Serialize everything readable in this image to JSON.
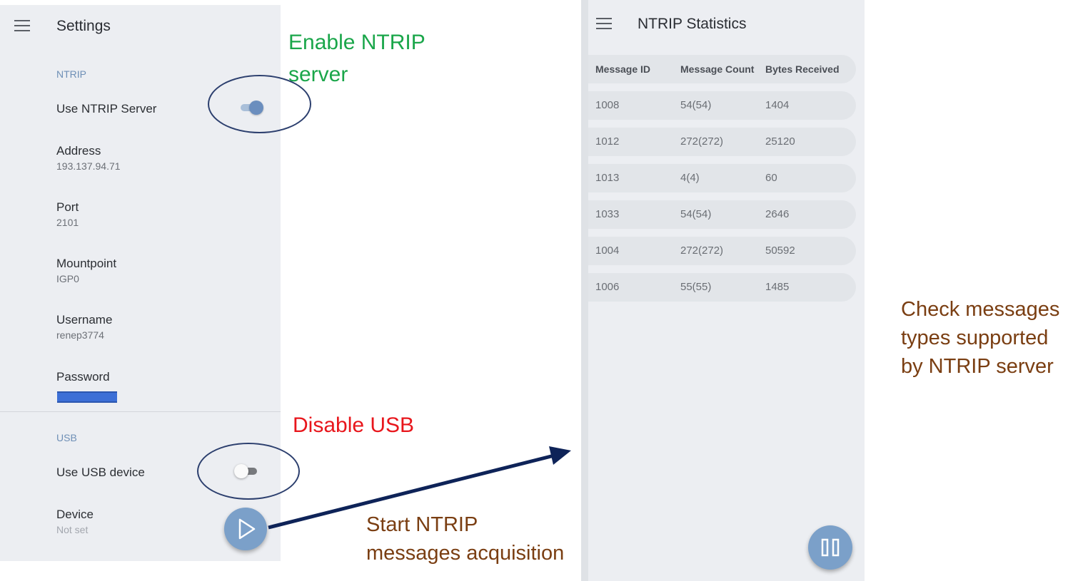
{
  "settings": {
    "title": "Settings",
    "ntrip_header": "NTRIP",
    "use_ntrip_label": "Use NTRIP Server",
    "use_ntrip_on": true,
    "address_label": "Address",
    "address_value": "193.137.94.71",
    "port_label": "Port",
    "port_value": "2101",
    "mountpoint_label": "Mountpoint",
    "mountpoint_value": "IGP0",
    "username_label": "Username",
    "username_value": "renep3774",
    "password_label": "Password",
    "usb_header": "USB",
    "use_usb_label": "Use USB device",
    "use_usb_on": false,
    "device_label": "Device",
    "device_value": "Not set"
  },
  "stats": {
    "title": "NTRIP Statistics",
    "columns": [
      "Message ID",
      "Message Count",
      "Bytes Received"
    ],
    "rows": [
      [
        "1008",
        "54(54)",
        "1404"
      ],
      [
        "1012",
        "272(272)",
        "25120"
      ],
      [
        "1013",
        "4(4)",
        "60"
      ],
      [
        "1033",
        "54(54)",
        "2646"
      ],
      [
        "1004",
        "272(272)",
        "50592"
      ],
      [
        "1006",
        "55(55)",
        "1485"
      ]
    ]
  },
  "annotations": {
    "enable_ntrip_line1": "Enable NTRIP",
    "enable_ntrip_line2": "server",
    "disable_usb": "Disable USB",
    "start_line1": "Start NTRIP",
    "start_line2": "messages acquisition",
    "check_line1": "Check messages",
    "check_line2": "types supported",
    "check_line3": "by NTRIP server",
    "colors": {
      "green": "#1aa64a",
      "red": "#e8161c",
      "brown": "#7a3e12",
      "ellipse": "#2c3f6e",
      "arrow": "#0e2358"
    }
  },
  "icons": {
    "menu": "hamburger-menu-icon",
    "play": "play-icon",
    "pause": "pause-icon"
  }
}
